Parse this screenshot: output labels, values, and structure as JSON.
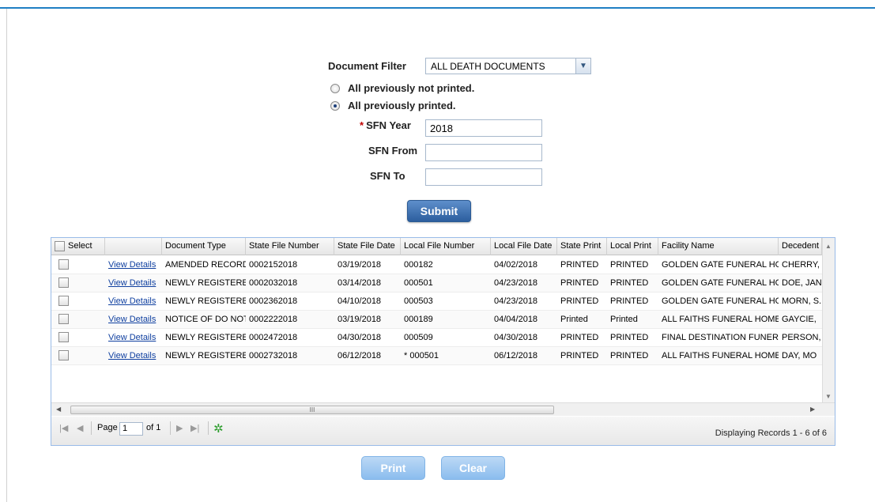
{
  "filter": {
    "document_filter_label": "Document Filter",
    "document_filter_value": "ALL DEATH DOCUMENTS",
    "radio_not_printed": "All previously not printed.",
    "radio_printed": "All previously printed.",
    "selected_radio": "printed",
    "required_mark": "*",
    "sfn_year_label": "SFN Year",
    "sfn_year_value": "2018",
    "sfn_from_label": "SFN From",
    "sfn_from_value": "",
    "sfn_to_label": "SFN To",
    "sfn_to_value": "",
    "submit_label": "Submit"
  },
  "grid": {
    "columns": [
      "Select",
      "",
      "Document Type",
      "State File Number",
      "State File Date",
      "Local File Number",
      "Local File Date",
      "State Print",
      "Local Print",
      "Facility Name",
      "Decedent"
    ],
    "rows": [
      {
        "link": "View Details",
        "doc_type": "AMENDED RECORD",
        "state_file_number": "0002152018",
        "state_file_date": "03/19/2018",
        "local_file_number": "000182",
        "local_file_date": "04/02/2018",
        "state_print": "PRINTED",
        "local_print": "PRINTED",
        "facility": "GOLDEN GATE FUNERAL HOM",
        "decedent": "CHERRY,"
      },
      {
        "link": "View Details",
        "doc_type": "NEWLY REGISTERE",
        "state_file_number": "0002032018",
        "state_file_date": "03/14/2018",
        "local_file_number": "000501",
        "local_file_date": "04/23/2018",
        "state_print": "PRINTED",
        "local_print": "PRINTED",
        "facility": "GOLDEN GATE FUNERAL HOM",
        "decedent": "DOE, JAN"
      },
      {
        "link": "View Details",
        "doc_type": "NEWLY REGISTERE",
        "state_file_number": "0002362018",
        "state_file_date": "04/10/2018",
        "local_file_number": "000503",
        "local_file_date": "04/23/2018",
        "state_print": "PRINTED",
        "local_print": "PRINTED",
        "facility": "GOLDEN GATE FUNERAL HOM",
        "decedent": "MORN, S."
      },
      {
        "link": "View Details",
        "doc_type": "NOTICE OF DO NOT",
        "state_file_number": "0002222018",
        "state_file_date": "03/19/2018",
        "local_file_number": "000189",
        "local_file_date": "04/04/2018",
        "state_print": "Printed",
        "local_print": "Printed",
        "facility": "ALL FAITHS FUNERAL HOME-",
        "decedent": "GAYCIE,"
      },
      {
        "link": "View Details",
        "doc_type": "NEWLY REGISTERE",
        "state_file_number": "0002472018",
        "state_file_date": "04/30/2018",
        "local_file_number": "000509",
        "local_file_date": "04/30/2018",
        "state_print": "PRINTED",
        "local_print": "PRINTED",
        "facility": "FINAL DESTINATION FUNERAL",
        "decedent": "PERSON,"
      },
      {
        "link": "View Details",
        "doc_type": "NEWLY REGISTERE",
        "state_file_number": "0002732018",
        "state_file_date": "06/12/2018",
        "local_file_number": "* 000501",
        "local_file_date": "06/12/2018",
        "state_print": "PRINTED",
        "local_print": "PRINTED",
        "facility": "ALL FAITHS FUNERAL HOME-",
        "decedent": "DAY, MO"
      }
    ]
  },
  "pager": {
    "page_label": "Page",
    "page_value": "1",
    "of_label": "of 1",
    "display_text": "Displaying Records 1 - 6 of 6"
  },
  "actions": {
    "print_label": "Print",
    "clear_label": "Clear"
  },
  "colors": {
    "accent": "#1f7fc4",
    "submit": "#3a6aab",
    "link": "#1040a0",
    "disabled_button": "#a9cdf1"
  }
}
